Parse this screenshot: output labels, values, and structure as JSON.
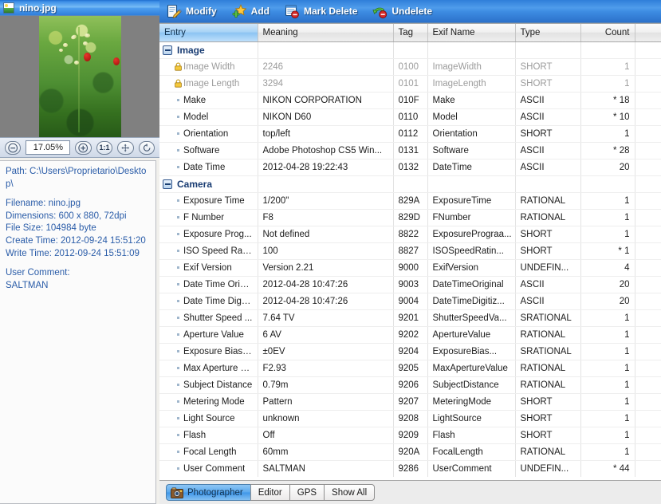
{
  "window": {
    "file_title": "nino.jpg",
    "file_icon": "image-file-icon"
  },
  "toolbar": {
    "buttons": [
      {
        "label": "Modify",
        "icon": "pencil-notepad-icon"
      },
      {
        "label": "Add",
        "icon": "star-plus-icon"
      },
      {
        "label": "Mark Delete",
        "icon": "document-delete-icon"
      },
      {
        "label": "Undelete",
        "icon": "undo-delete-icon"
      }
    ]
  },
  "preview": {
    "zoom_value": "17.05%",
    "buttons": {
      "zoom_out": "minus-icon",
      "zoom_in": "plus-icon",
      "actual_size": "1:1",
      "fit_to_window": "fit-arrows-icon",
      "rotate": "rotate-icon"
    }
  },
  "info": {
    "path": "Path: C:\\Users\\Proprietario\\Desktop\\",
    "filename": "Filename: nino.jpg",
    "dimensions": "Dimensions: 600 x 880, 72dpi",
    "filesize": "File Size: 104984 byte",
    "create_time": "Create Time: 2012-09-24 15:51:20",
    "write_time": "Write Time: 2012-09-24 15:51:09",
    "user_comment_label": "User Comment:",
    "user_comment_value": "SALTMAN"
  },
  "table": {
    "columns": [
      {
        "label": "Entry",
        "sorted": true,
        "align": "left"
      },
      {
        "label": "Meaning",
        "sorted": false,
        "align": "left"
      },
      {
        "label": "Tag",
        "sorted": false,
        "align": "left"
      },
      {
        "label": "Exif Name",
        "sorted": false,
        "align": "left"
      },
      {
        "label": "Type",
        "sorted": false,
        "align": "left"
      },
      {
        "label": "Count",
        "sorted": false,
        "align": "right"
      }
    ],
    "rows": [
      {
        "kind": "group",
        "entry": "Image",
        "expanded": true
      },
      {
        "kind": "item",
        "readonly": true,
        "icon": "lock-icon",
        "entry": "Image Width",
        "meaning": "2246",
        "tag": "0100",
        "exif": "ImageWidth",
        "type": "SHORT",
        "count": "1"
      },
      {
        "kind": "item",
        "readonly": true,
        "icon": "lock-icon",
        "entry": "Image Length",
        "meaning": "3294",
        "tag": "0101",
        "exif": "ImageLength",
        "type": "SHORT",
        "count": "1"
      },
      {
        "kind": "item",
        "readonly": false,
        "icon": "dot-icon",
        "entry": "Make",
        "meaning": "NIKON CORPORATION",
        "tag": "010F",
        "exif": "Make",
        "type": "ASCII",
        "count": "* 18"
      },
      {
        "kind": "item",
        "readonly": false,
        "icon": "dot-icon",
        "entry": "Model",
        "meaning": "NIKON D60",
        "tag": "0110",
        "exif": "Model",
        "type": "ASCII",
        "count": "* 10"
      },
      {
        "kind": "item",
        "readonly": false,
        "icon": "dot-icon",
        "entry": "Orientation",
        "meaning": "top/left",
        "tag": "0112",
        "exif": "Orientation",
        "type": "SHORT",
        "count": "1"
      },
      {
        "kind": "item",
        "readonly": false,
        "icon": "dot-icon",
        "entry": "Software",
        "meaning": "Adobe Photoshop CS5 Win...",
        "tag": "0131",
        "exif": "Software",
        "type": "ASCII",
        "count": "* 28"
      },
      {
        "kind": "item",
        "readonly": false,
        "icon": "dot-icon",
        "entry": "Date Time",
        "meaning": "2012-04-28 19:22:43",
        "tag": "0132",
        "exif": "DateTime",
        "type": "ASCII",
        "count": "20"
      },
      {
        "kind": "group",
        "entry": "Camera",
        "expanded": true
      },
      {
        "kind": "item",
        "readonly": false,
        "icon": "dot-icon",
        "entry": "Exposure Time",
        "meaning": "1/200\"",
        "tag": "829A",
        "exif": "ExposureTime",
        "type": "RATIONAL",
        "count": "1"
      },
      {
        "kind": "item",
        "readonly": false,
        "icon": "dot-icon",
        "entry": "F Number",
        "meaning": "F8",
        "tag": "829D",
        "exif": "FNumber",
        "type": "RATIONAL",
        "count": "1"
      },
      {
        "kind": "item",
        "readonly": false,
        "icon": "dot-icon",
        "entry": "Exposure Prog...",
        "meaning": "Not defined",
        "tag": "8822",
        "exif": "ExposurePrograa...",
        "type": "SHORT",
        "count": "1"
      },
      {
        "kind": "item",
        "readonly": false,
        "icon": "dot-icon",
        "entry": "ISO Speed Rati...",
        "meaning": "100",
        "tag": "8827",
        "exif": "ISOSpeedRatin...",
        "type": "SHORT",
        "count": "* 1"
      },
      {
        "kind": "item",
        "readonly": false,
        "icon": "dot-icon",
        "entry": "Exif Version",
        "meaning": "Version 2.21",
        "tag": "9000",
        "exif": "ExifVersion",
        "type": "UNDEFIN...",
        "count": "4"
      },
      {
        "kind": "item",
        "readonly": false,
        "icon": "dot-icon",
        "entry": "Date Time Orig...",
        "meaning": "2012-04-28 10:47:26",
        "tag": "9003",
        "exif": "DateTimeOriginal",
        "type": "ASCII",
        "count": "20"
      },
      {
        "kind": "item",
        "readonly": false,
        "icon": "dot-icon",
        "entry": "Date Time Digit...",
        "meaning": "2012-04-28 10:47:26",
        "tag": "9004",
        "exif": "DateTimeDigitiz...",
        "type": "ASCII",
        "count": "20"
      },
      {
        "kind": "item",
        "readonly": false,
        "icon": "dot-icon",
        "entry": "Shutter Speed ...",
        "meaning": "7.64 TV",
        "tag": "9201",
        "exif": "ShutterSpeedVa...",
        "type": "SRATIONAL",
        "count": "1"
      },
      {
        "kind": "item",
        "readonly": false,
        "icon": "dot-icon",
        "entry": "Aperture Value",
        "meaning": "6 AV",
        "tag": "9202",
        "exif": "ApertureValue",
        "type": "RATIONAL",
        "count": "1"
      },
      {
        "kind": "item",
        "readonly": false,
        "icon": "dot-icon",
        "entry": "Exposure Bias ...",
        "meaning": "±0EV",
        "tag": "9204",
        "exif": "ExposureBias...",
        "type": "SRATIONAL",
        "count": "1"
      },
      {
        "kind": "item",
        "readonly": false,
        "icon": "dot-icon",
        "entry": "Max Aperture Va...",
        "meaning": "F2.93",
        "tag": "9205",
        "exif": "MaxApertureValue",
        "type": "RATIONAL",
        "count": "1"
      },
      {
        "kind": "item",
        "readonly": false,
        "icon": "dot-icon",
        "entry": "Subject Distance",
        "meaning": "0.79m",
        "tag": "9206",
        "exif": "SubjectDistance",
        "type": "RATIONAL",
        "count": "1"
      },
      {
        "kind": "item",
        "readonly": false,
        "icon": "dot-icon",
        "entry": "Metering Mode",
        "meaning": "Pattern",
        "tag": "9207",
        "exif": "MeteringMode",
        "type": "SHORT",
        "count": "1"
      },
      {
        "kind": "item",
        "readonly": false,
        "icon": "dot-icon",
        "entry": "Light Source",
        "meaning": "unknown",
        "tag": "9208",
        "exif": "LightSource",
        "type": "SHORT",
        "count": "1"
      },
      {
        "kind": "item",
        "readonly": false,
        "icon": "dot-icon",
        "entry": "Flash",
        "meaning": "Off",
        "tag": "9209",
        "exif": "Flash",
        "type": "SHORT",
        "count": "1"
      },
      {
        "kind": "item",
        "readonly": false,
        "icon": "dot-icon",
        "entry": "Focal Length",
        "meaning": "60mm",
        "tag": "920A",
        "exif": "FocalLength",
        "type": "RATIONAL",
        "count": "1"
      },
      {
        "kind": "item",
        "readonly": false,
        "icon": "dot-icon",
        "entry": "User Comment",
        "meaning": "SALTMAN",
        "tag": "9286",
        "exif": "UserComment",
        "type": "UNDEFIN...",
        "count": "* 44",
        "clipped": true
      }
    ]
  },
  "tabs": [
    {
      "label": "Photographer",
      "active": true,
      "icon": "camera-photographer-icon"
    },
    {
      "label": "Editor",
      "active": false,
      "icon": ""
    },
    {
      "label": "GPS",
      "active": false,
      "icon": ""
    },
    {
      "label": "Show All",
      "active": false,
      "icon": ""
    }
  ],
  "colors": {
    "titlebar_blue": "#3f91e8",
    "toolbar_blue": "#3d8ce2",
    "sorted_header": "#8cc4f2",
    "info_text": "#2a5ca8",
    "readonly_text": "#9b9b9b"
  }
}
